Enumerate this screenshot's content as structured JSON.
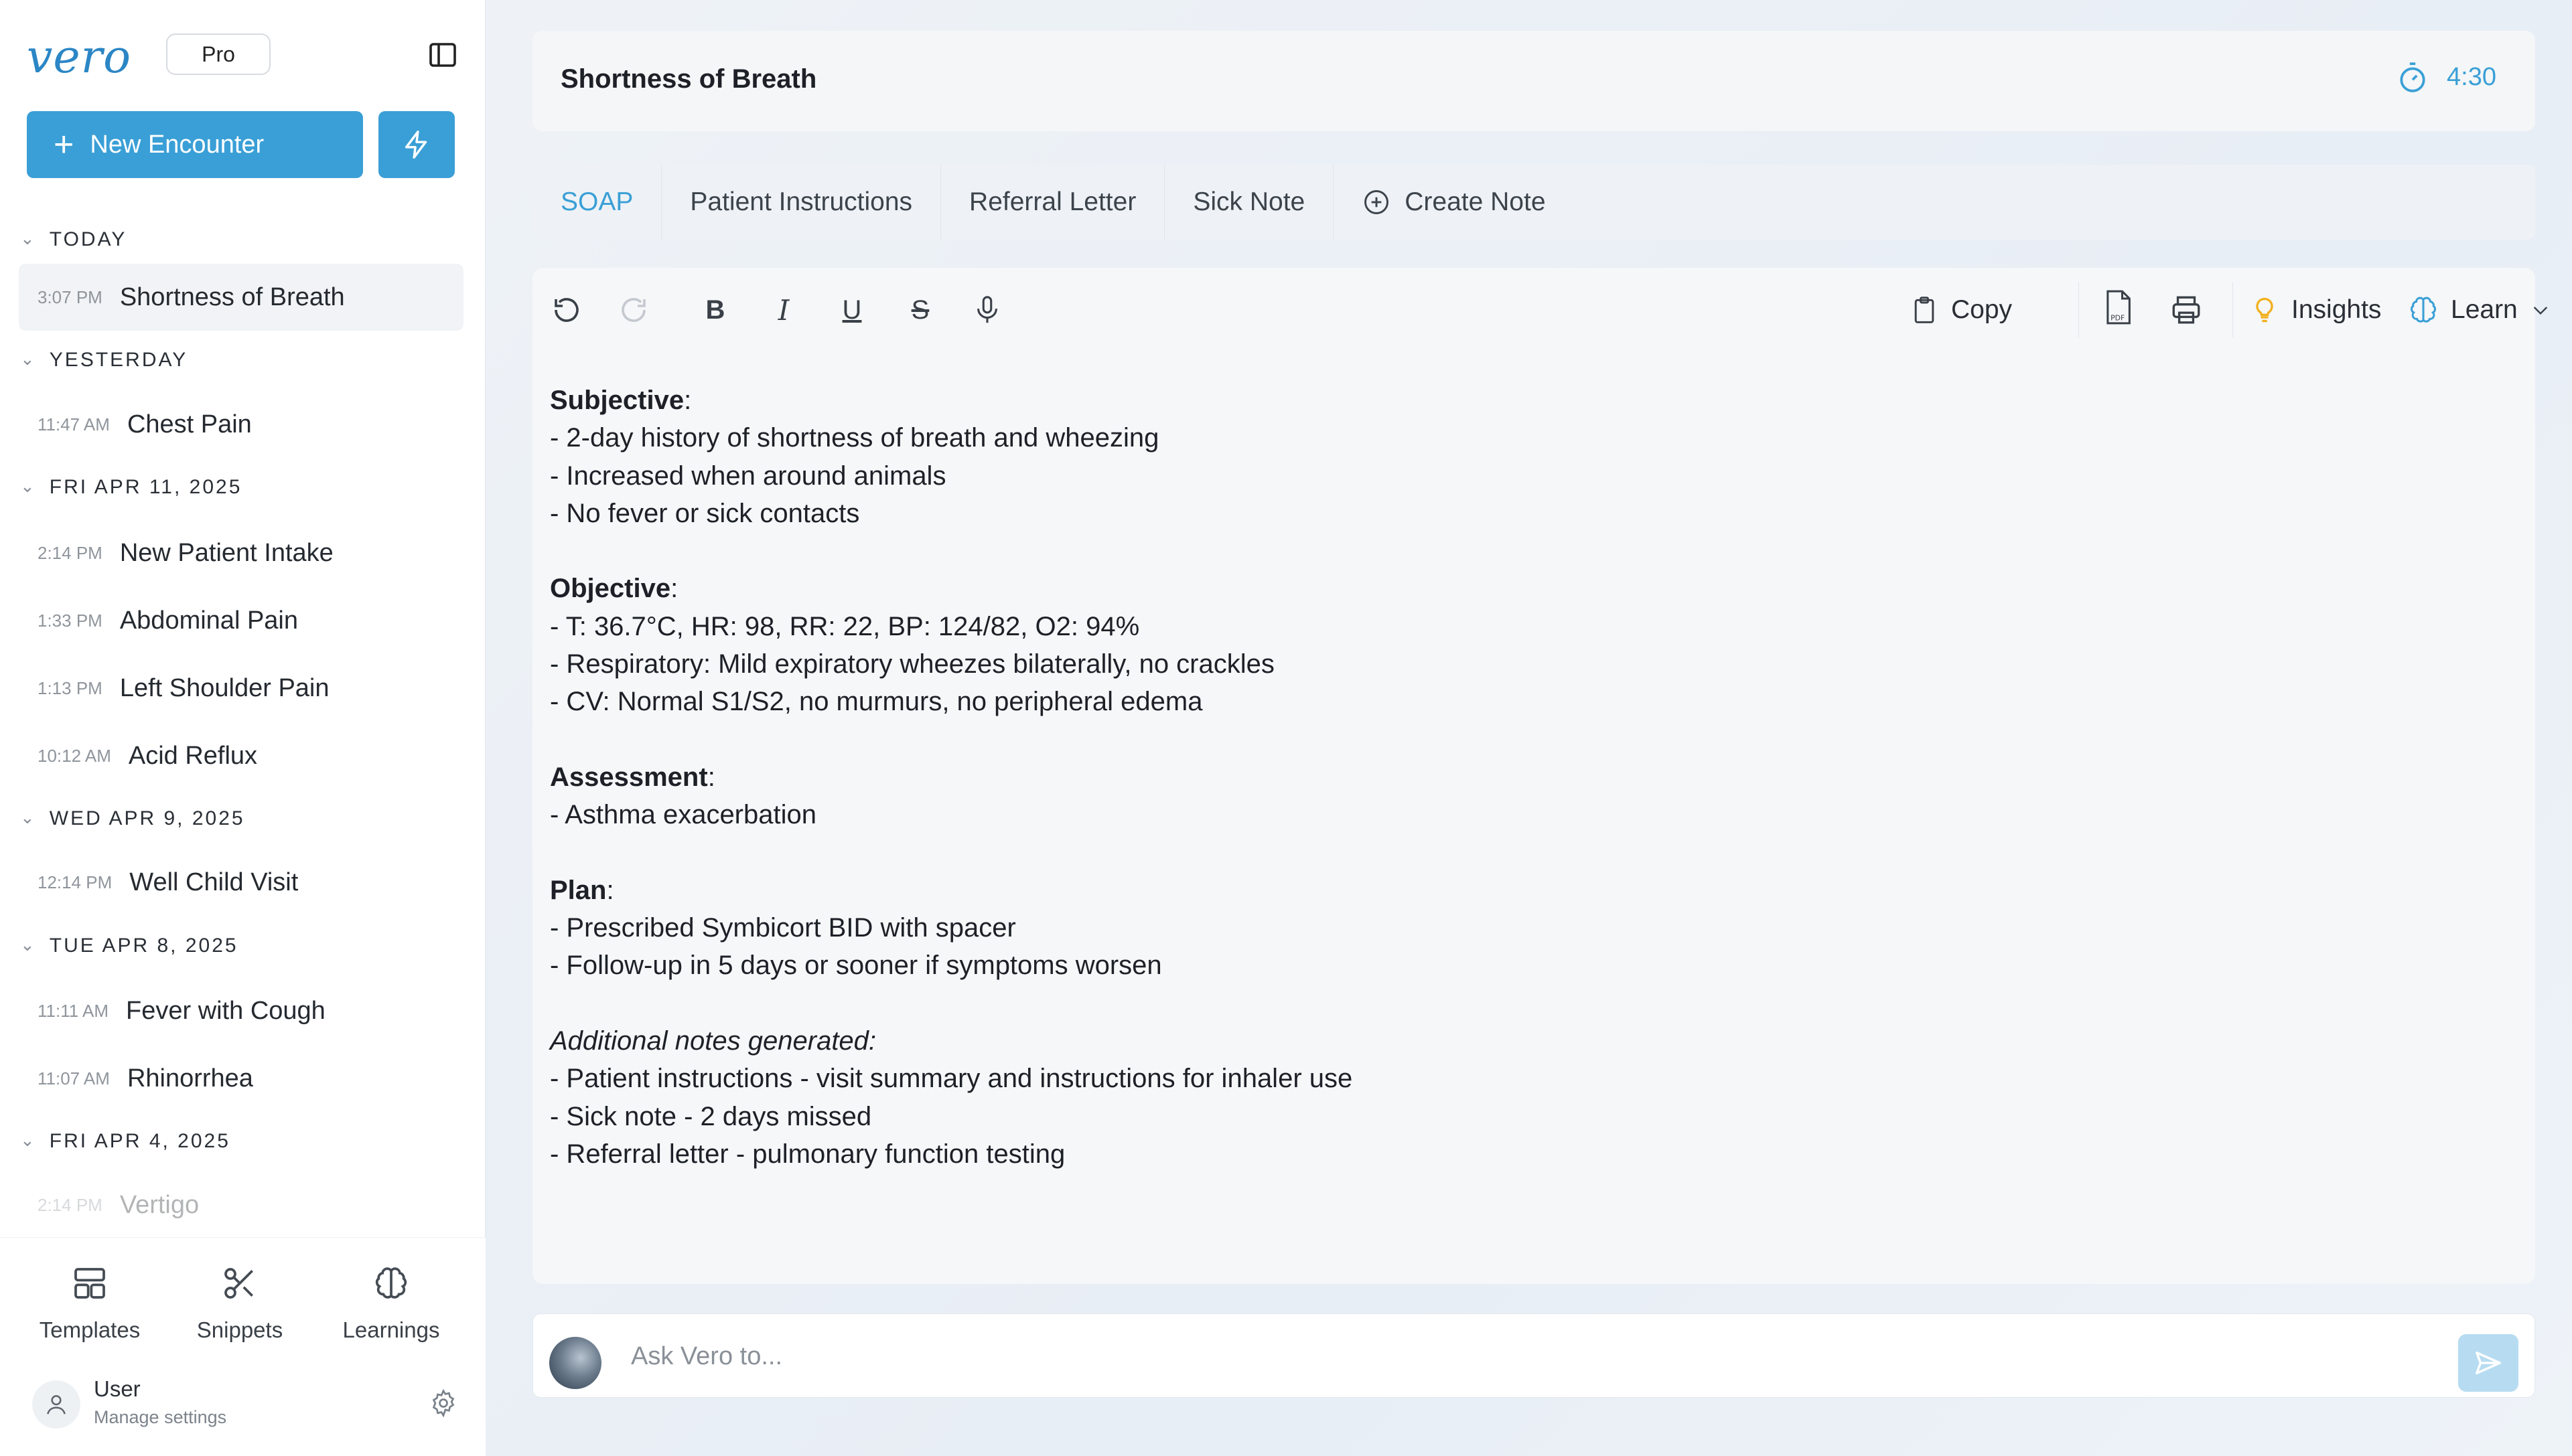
{
  "brand": {
    "logo": "vero",
    "plan_badge": "Pro"
  },
  "sidebar": {
    "new_encounter_label": "New Encounter",
    "groups": [
      {
        "label": "TODAY",
        "items": [
          {
            "time": "3:07 PM",
            "title": "Shortness of Breath",
            "active": true
          }
        ]
      },
      {
        "label": "YESTERDAY",
        "items": [
          {
            "time": "11:47 AM",
            "title": "Chest Pain"
          }
        ]
      },
      {
        "label": "FRI APR 11, 2025",
        "items": [
          {
            "time": "2:14 PM",
            "title": "New Patient Intake"
          },
          {
            "time": "1:33 PM",
            "title": "Abdominal Pain"
          },
          {
            "time": "1:13 PM",
            "title": "Left Shoulder Pain"
          },
          {
            "time": "10:12 AM",
            "title": "Acid Reflux"
          }
        ]
      },
      {
        "label": "WED APR 9, 2025",
        "items": [
          {
            "time": "12:14 PM",
            "title": "Well Child Visit"
          }
        ]
      },
      {
        "label": "TUE APR 8, 2025",
        "items": [
          {
            "time": "11:11 AM",
            "title": "Fever with Cough"
          },
          {
            "time": "11:07 AM",
            "title": "Rhinorrhea"
          }
        ]
      },
      {
        "label": "FRI APR 4, 2025",
        "items": [
          {
            "time": "2:14 PM",
            "title": "Vertigo"
          }
        ]
      }
    ],
    "bottom_nav": {
      "templates": "Templates",
      "snippets": "Snippets",
      "learnings": "Learnings"
    },
    "user": {
      "name": "User",
      "subtitle": "Manage settings"
    }
  },
  "header": {
    "title": "Shortness of Breath",
    "timer": "4:30"
  },
  "tabs": [
    "SOAP",
    "Patient Instructions",
    "Referral Letter",
    "Sick Note",
    "Create Note"
  ],
  "toolbar": {
    "copy": "Copy",
    "insights": "Insights",
    "learn": "Learn"
  },
  "note": {
    "subjective_heading": "Subjective",
    "subjective": [
      "- 2-day history of shortness of breath and wheezing",
      "- Increased when around animals",
      "- No fever or sick contacts"
    ],
    "objective_heading": "Objective",
    "objective": [
      "- T: 36.7°C, HR: 98, RR: 22, BP: 124/82, O2: 94%",
      "- Respiratory: Mild expiratory wheezes bilaterally, no crackles",
      "- CV: Normal S1/S2, no murmurs, no peripheral edema"
    ],
    "assessment_heading": "Assessment",
    "assessment": [
      "- Asthma exacerbation"
    ],
    "plan_heading": "Plan",
    "plan": [
      "- Prescribed Symbicort BID with spacer",
      "- Follow-up in 5 days or sooner if symptoms worsen"
    ],
    "additional_heading": "Additional notes generated:",
    "additional": [
      "- Patient instructions - visit summary and instructions for inhaler use",
      "- Sick note - 2 days missed",
      "- Referral letter - pulmonary function testing"
    ]
  },
  "ask": {
    "placeholder": "Ask Vero to..."
  },
  "colors": {
    "accent": "#3a9fd6",
    "send_button": "#b7dcf1",
    "insights_bulb": "#f2b01e"
  }
}
